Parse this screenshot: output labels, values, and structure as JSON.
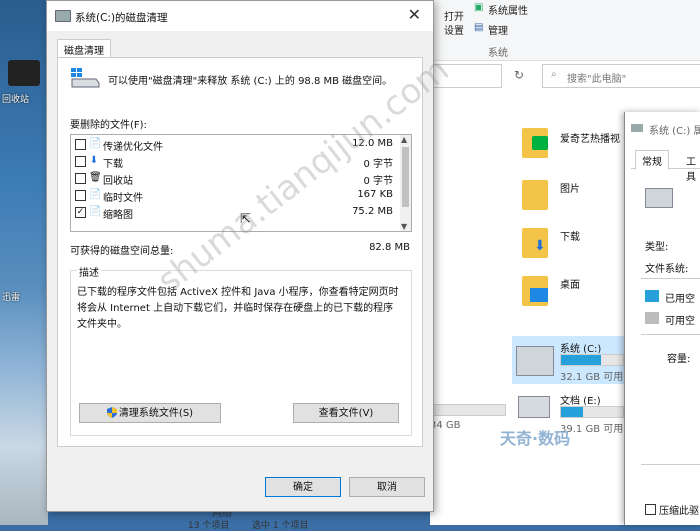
{
  "desktop": {
    "label_1": "回收站",
    "label_2": "迅雷"
  },
  "explorer": {
    "ribbon": {
      "open_label": "打开",
      "settings_label": "设置",
      "system_props_label": "系统属性",
      "manage_label": "管理",
      "group_label": "系统"
    },
    "search_placeholder": "搜索\"此电脑\"",
    "items": [
      {
        "label": "爱奇艺热播视"
      },
      {
        "label": "图片"
      },
      {
        "label": "下载"
      },
      {
        "label": "桌面"
      }
    ],
    "drives": [
      {
        "label": "系统 (C:)",
        "sub": "32.1 GB 可用",
        "used_fraction": 0.65
      },
      {
        "label": "文档 (E:)",
        "sub": "39.1 GB 可用",
        "used_fraction": 0.35
      }
    ],
    "other_drive_text": "34 GB",
    "network_label": "网络",
    "status_left": "13 个项目",
    "status_right": "选中 1 个项目"
  },
  "props": {
    "title": "系统 (C:) 属",
    "tabs": [
      "常规",
      "工具"
    ],
    "type_label": "类型:",
    "fs_label": "文件系统:",
    "used_label": "已用空",
    "free_label": "可用空",
    "capacity_label": "容量:",
    "compress_label": "压缩此驱"
  },
  "dialog": {
    "title": "系统(C:)的磁盘清理",
    "tab": "磁盘清理",
    "intro": "可以使用\"磁盘清理\"来释放 系统 (C:) 上的 98.8 MB 磁盘空间。",
    "files_label": "要删除的文件(F):",
    "files": [
      {
        "name": "传递优化文件",
        "size": "12.0 MB",
        "checked": "",
        "icon": "📄"
      },
      {
        "name": "下载",
        "size": "0 字节",
        "checked": "",
        "icon": "⬇"
      },
      {
        "name": "回收站",
        "size": "0 字节",
        "checked": "",
        "icon": "🗑"
      },
      {
        "name": "临时文件",
        "size": "167 KB",
        "checked": "",
        "icon": "📄"
      },
      {
        "name": "缩略图",
        "size": "75.2 MB",
        "checked": "✓",
        "icon": "📄"
      }
    ],
    "total_label": "可获得的磁盘空间总量:",
    "total_value": "82.8 MB",
    "desc_legend": "描述",
    "description": "已下载的程序文件包括 ActiveX 控件和 Java 小程序，你查看特定网页时将会从 Internet 上自动下载它们，并临时保存在硬盘上的已下载的程序文件夹中。",
    "clean_system_button": "清理系统文件(S)",
    "view_files_button": "查看文件(V)",
    "ok_button": "确定",
    "cancel_button": "取消"
  },
  "watermark": {
    "text": "shuma.tianqijun.com",
    "brand": "天奇·数码"
  },
  "colors": {
    "accent": "#0078d7",
    "drive_fill": "#26a0da"
  }
}
